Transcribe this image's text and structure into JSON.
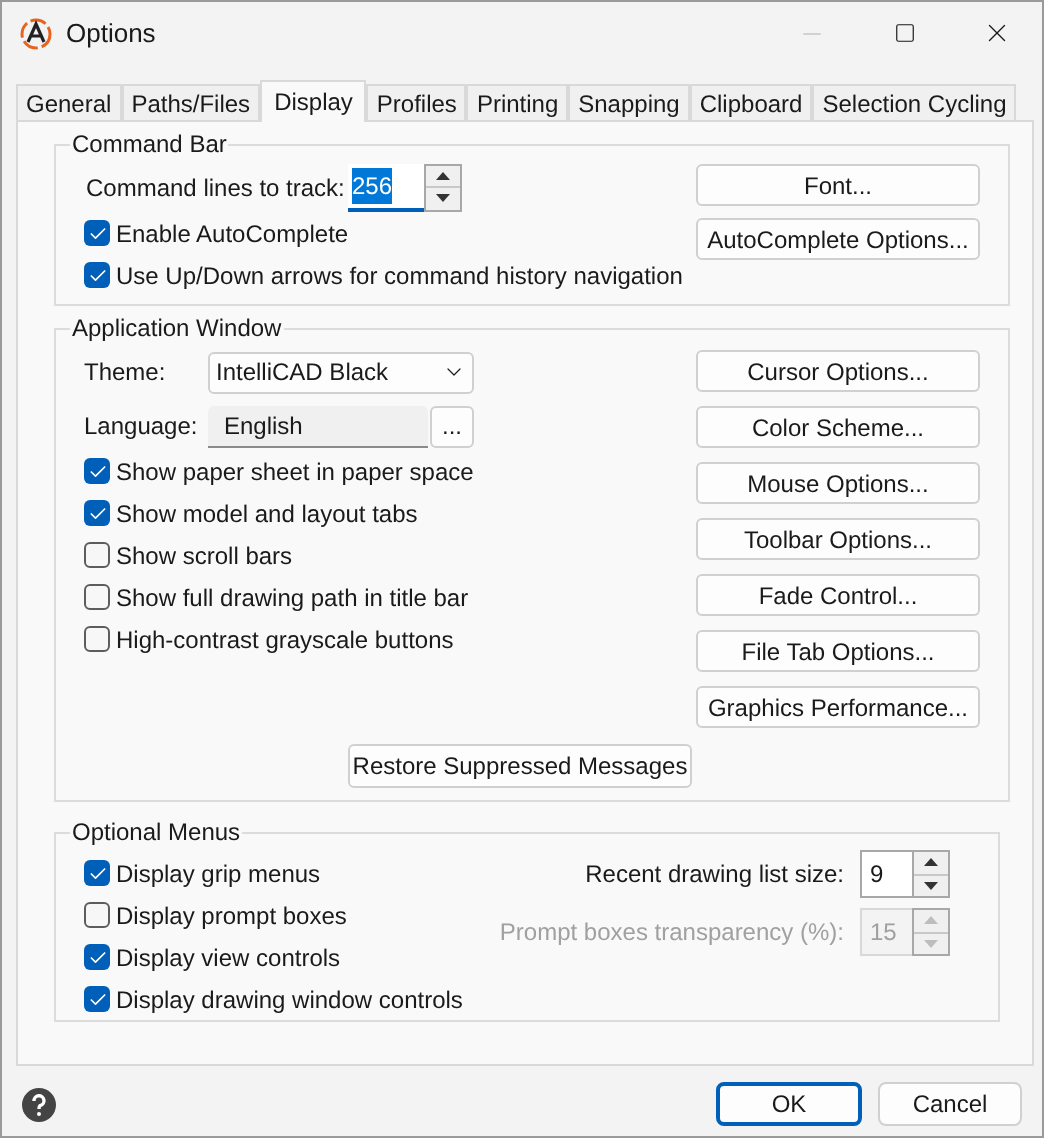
{
  "window": {
    "title": "Options"
  },
  "tabs": [
    {
      "label": "General",
      "selected": false
    },
    {
      "label": "Paths/Files",
      "selected": false
    },
    {
      "label": "Display",
      "selected": true
    },
    {
      "label": "Profiles",
      "selected": false
    },
    {
      "label": "Printing",
      "selected": false
    },
    {
      "label": "Snapping",
      "selected": false
    },
    {
      "label": "Clipboard",
      "selected": false
    },
    {
      "label": "Selection Cycling",
      "selected": false
    }
  ],
  "command_bar": {
    "title": "Command Bar",
    "lines_label": "Command lines to track:",
    "lines_value": "256",
    "checkboxes": [
      {
        "label": "Enable AutoComplete",
        "checked": true
      },
      {
        "label": "Use Up/Down arrows for command history navigation",
        "checked": true
      }
    ],
    "buttons": [
      "Font...",
      "AutoComplete Options..."
    ]
  },
  "application_window": {
    "title": "Application Window",
    "theme_label": "Theme:",
    "theme_value": "IntelliCAD Black",
    "language_label": "Language:",
    "language_value": "English",
    "browse_button": "...",
    "checkboxes": [
      {
        "label": "Show paper sheet in paper space",
        "checked": true
      },
      {
        "label": "Show model and layout tabs",
        "checked": true
      },
      {
        "label": "Show scroll bars",
        "checked": false
      },
      {
        "label": "Show full drawing path in title bar",
        "checked": false
      },
      {
        "label": "High-contrast grayscale buttons",
        "checked": false
      }
    ],
    "buttons": [
      "Cursor Options...",
      "Color Scheme...",
      "Mouse Options...",
      "Toolbar Options...",
      "Fade Control...",
      "File Tab Options...",
      "Graphics Performance..."
    ],
    "restore_button": "Restore Suppressed Messages"
  },
  "optional_menus": {
    "title": "Optional Menus",
    "checkboxes": [
      {
        "label": "Display grip menus",
        "checked": true
      },
      {
        "label": "Display prompt boxes",
        "checked": false
      },
      {
        "label": "Display view controls",
        "checked": true
      },
      {
        "label": "Display drawing window controls",
        "checked": true
      }
    ],
    "spinners": [
      {
        "label": "Recent drawing list size:",
        "value": "9",
        "disabled": false
      },
      {
        "label": "Prompt boxes transparency (%):",
        "value": "15",
        "disabled": true
      }
    ]
  },
  "buttons": [
    {
      "label": "OK",
      "default": true
    },
    {
      "label": "Cancel",
      "default": false
    }
  ]
}
